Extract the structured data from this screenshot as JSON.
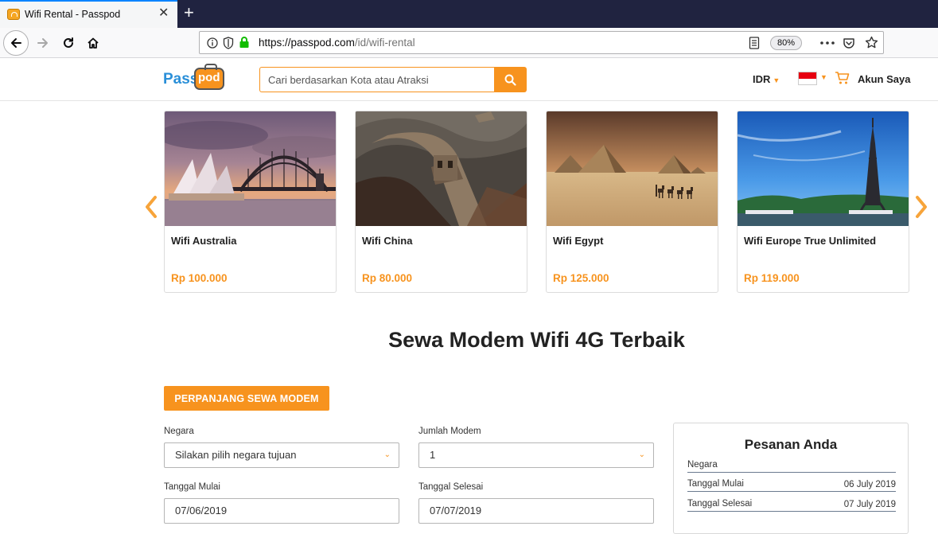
{
  "browser": {
    "tab_title": "Wifi Rental - Passpod",
    "tab_close": "✕",
    "new_tab": "+",
    "url_host": "https://passpod.com",
    "url_path": "/id/wifi-rental",
    "zoom": "80%"
  },
  "header": {
    "logo_pass": "Pass",
    "logo_pod": "pod",
    "search_placeholder": "Cari berdasarkan Kota atau Atraksi",
    "currency": "IDR",
    "account": "Akun Saya"
  },
  "products": [
    {
      "title": "Wifi Australia",
      "price": "Rp 100.000"
    },
    {
      "title": "Wifi China",
      "price": "Rp 80.000"
    },
    {
      "title": "Wifi Egypt",
      "price": "Rp 125.000"
    },
    {
      "title": "Wifi Europe True Unlimited",
      "price": "Rp 119.000"
    }
  ],
  "main": {
    "heading": "Sewa Modem Wifi 4G Terbaik",
    "extend_button": "PERPANJANG SEWA MODEM",
    "form": {
      "country_label": "Negara",
      "country_value": "Silakan pilih negara tujuan",
      "quantity_label": "Jumlah Modem",
      "quantity_value": "1",
      "start_label": "Tanggal Mulai",
      "start_value": "07/06/2019",
      "end_label": "Tanggal Selesai",
      "end_value": "07/07/2019"
    }
  },
  "summary": {
    "title": "Pesanan Anda",
    "rows": [
      {
        "key": "Negara",
        "value": ""
      },
      {
        "key": "Tanggal Mulai",
        "value": "06 July 2019"
      },
      {
        "key": "Tanggal Selesai",
        "value": "07 July 2019"
      }
    ]
  },
  "colors": {
    "brand_orange": "#f7931e",
    "brand_blue": "#2a8fd8",
    "tabbar": "#202340"
  }
}
